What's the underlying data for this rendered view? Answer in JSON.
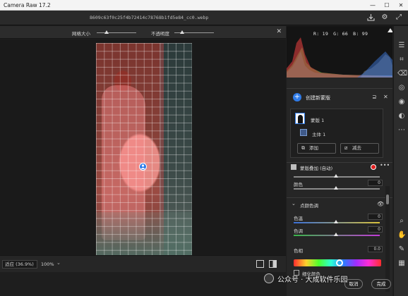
{
  "app": {
    "title": "Camera Raw 17.2",
    "file_name": "8609c63f0c25f4b72414c78768b1fd5e84_cc0.webp"
  },
  "window_controls": {
    "minimize": "—",
    "maximize": "☐",
    "close": "✕"
  },
  "header_icons": [
    "download-icon",
    "gear-icon",
    "expand-icon"
  ],
  "option_bar": {
    "brush_size_label": "网格大小",
    "opacity_label": "不透明度",
    "brush_size_value": 0.25,
    "opacity_value": 0.2
  },
  "canvas": {
    "image_description_icon": "person-pin-icon"
  },
  "status_bar": {
    "zoom_fit_label": "适应 (36.9%)",
    "zoom_100_label": "100%",
    "caret": "⌄"
  },
  "histogram": {
    "r": "R: 19",
    "g": "G: 66",
    "b": "B: 99"
  },
  "panel": {
    "create_mask_label": "创建新蒙版",
    "mask_name": "蒙版 1",
    "subject_label": "主体 1",
    "add_button": "添加",
    "subtract_button": "减去",
    "section_title": "蒙版叠加 (自动)",
    "section_color": "#e01e1e",
    "partial_label": "颜色",
    "partial_value": "0",
    "point_color_title": "点颜色调",
    "hue_label": "色温",
    "hue_value": "0",
    "tint_label": "色调",
    "tint_value": "0",
    "color_label": "色相",
    "color_value": "0.0",
    "hue_bar_value": 0.5,
    "bottom_label": "细化颜色"
  },
  "watermark": {
    "text": "公众号 · 大成软件乐园"
  },
  "bottom_buttons": {
    "cancel": "取消",
    "done": "完成"
  }
}
